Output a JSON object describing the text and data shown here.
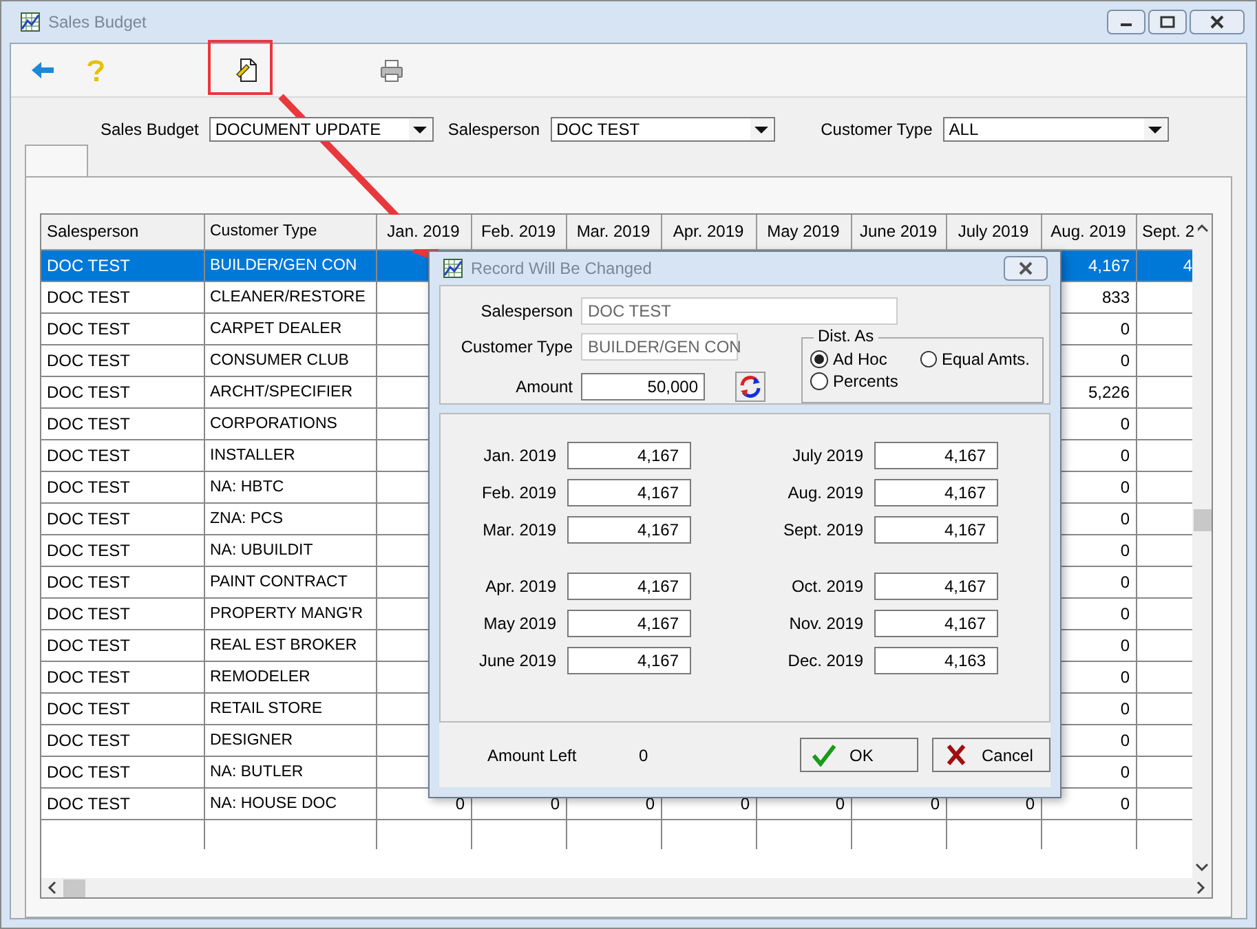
{
  "window": {
    "title": "Sales Budget"
  },
  "toolbar": [
    {
      "kind": "back"
    },
    {
      "kind": "help"
    },
    {
      "kind": "edit",
      "highlighted": true
    },
    {
      "kind": "print"
    }
  ],
  "filters": [
    {
      "label": "Sales Budget",
      "value": "DOCUMENT UPDATE"
    },
    {
      "label": "Salesperson",
      "value": "DOC TEST"
    },
    {
      "label": "Customer Type",
      "value": "ALL"
    }
  ],
  "table": {
    "columns": [
      "Salesperson",
      "Customer Type",
      "Jan. 2019",
      "Feb. 2019",
      "Mar. 2019",
      "Apr. 2019",
      "May 2019",
      "June 2019",
      "July 2019",
      "Aug. 2019",
      "Sept. 2"
    ],
    "rows": [
      {
        "selected": true,
        "cells": [
          "DOC TEST",
          "BUILDER/GEN CON",
          null,
          null,
          null,
          null,
          null,
          null,
          null,
          "4,167",
          "4"
        ]
      },
      {
        "selected": false,
        "cells": [
          "DOC TEST",
          "CLEANER/RESTORE",
          null,
          null,
          null,
          null,
          null,
          null,
          null,
          "833",
          null
        ]
      },
      {
        "selected": false,
        "cells": [
          "DOC TEST",
          "CARPET DEALER",
          null,
          null,
          null,
          null,
          null,
          null,
          null,
          "0",
          null
        ]
      },
      {
        "selected": false,
        "cells": [
          "DOC TEST",
          "CONSUMER CLUB",
          null,
          null,
          null,
          null,
          null,
          null,
          null,
          "0",
          null
        ]
      },
      {
        "selected": false,
        "cells": [
          "DOC TEST",
          "ARCHT/SPECIFIER",
          null,
          null,
          null,
          null,
          null,
          null,
          null,
          "5,226",
          null
        ]
      },
      {
        "selected": false,
        "cells": [
          "DOC TEST",
          "CORPORATIONS",
          null,
          null,
          null,
          null,
          null,
          null,
          null,
          "0",
          null
        ]
      },
      {
        "selected": false,
        "cells": [
          "DOC TEST",
          "INSTALLER",
          null,
          null,
          null,
          null,
          null,
          null,
          null,
          "0",
          null
        ]
      },
      {
        "selected": false,
        "cells": [
          "DOC TEST",
          "NA: HBTC",
          null,
          null,
          null,
          null,
          null,
          null,
          null,
          "0",
          null
        ]
      },
      {
        "selected": false,
        "cells": [
          "DOC TEST",
          "ZNA: PCS",
          null,
          null,
          null,
          null,
          null,
          null,
          null,
          "0",
          null
        ]
      },
      {
        "selected": false,
        "cells": [
          "DOC TEST",
          "NA: UBUILDIT",
          null,
          null,
          null,
          null,
          null,
          null,
          null,
          "0",
          null
        ]
      },
      {
        "selected": false,
        "cells": [
          "DOC TEST",
          "PAINT CONTRACT",
          null,
          null,
          null,
          null,
          null,
          null,
          null,
          "0",
          null
        ]
      },
      {
        "selected": false,
        "cells": [
          "DOC TEST",
          "PROPERTY MANG'R",
          null,
          null,
          null,
          null,
          null,
          null,
          null,
          "0",
          null
        ]
      },
      {
        "selected": false,
        "cells": [
          "DOC TEST",
          "REAL EST BROKER",
          null,
          null,
          null,
          null,
          null,
          null,
          null,
          "0",
          null
        ]
      },
      {
        "selected": false,
        "cells": [
          "DOC TEST",
          "REMODELER",
          null,
          null,
          null,
          null,
          null,
          null,
          null,
          "0",
          null
        ]
      },
      {
        "selected": false,
        "cells": [
          "DOC TEST",
          "RETAIL STORE",
          null,
          null,
          null,
          null,
          null,
          null,
          null,
          "0",
          null
        ]
      },
      {
        "selected": false,
        "cells": [
          "DOC TEST",
          "DESIGNER",
          null,
          null,
          null,
          null,
          null,
          null,
          null,
          "0",
          null
        ]
      },
      {
        "selected": false,
        "cells": [
          "DOC TEST",
          "NA: BUTLER",
          null,
          null,
          null,
          null,
          null,
          null,
          null,
          "0",
          null
        ]
      },
      {
        "selected": false,
        "cells": [
          "DOC TEST",
          "NA: HOUSE DOC",
          "0",
          "0",
          "0",
          "0",
          "0",
          "0",
          "0",
          "0",
          null
        ]
      }
    ]
  },
  "dialog": {
    "title": "Record Will Be Changed",
    "fields": [
      {
        "label": "Salesperson",
        "value": "DOC TEST",
        "disabled": true
      },
      {
        "label": "Customer Type",
        "value": "BUILDER/GEN CON",
        "disabled": true
      },
      {
        "label": "Amount",
        "value": "50,000",
        "disabled": false
      }
    ],
    "dist": {
      "label": "Dist. As",
      "options": [
        {
          "label": "Ad Hoc",
          "selected": true
        },
        {
          "label": "Equal Amts.",
          "selected": false
        },
        {
          "label": "Percents",
          "selected": false
        }
      ]
    },
    "months": [
      [
        {
          "label": "Jan. 2019",
          "value": "4,167"
        },
        {
          "label": "Feb. 2019",
          "value": "4,167"
        },
        {
          "label": "Mar. 2019",
          "value": "4,167"
        },
        {
          "label": "Apr. 2019",
          "value": "4,167"
        },
        {
          "label": "May 2019",
          "value": "4,167"
        },
        {
          "label": "June 2019",
          "value": "4,167"
        }
      ],
      [
        {
          "label": "July 2019",
          "value": "4,167"
        },
        {
          "label": "Aug. 2019",
          "value": "4,167"
        },
        {
          "label": "Sept. 2019",
          "value": "4,167"
        },
        {
          "label": "Oct. 2019",
          "value": "4,167"
        },
        {
          "label": "Nov. 2019",
          "value": "4,167"
        },
        {
          "label": "Dec. 2019",
          "value": "4,163"
        }
      ]
    ],
    "amount_left": {
      "label": "Amount Left",
      "value": "0"
    },
    "buttons": [
      {
        "kind": "ok",
        "label": "OK"
      },
      {
        "kind": "cancel",
        "label": "Cancel"
      }
    ]
  }
}
